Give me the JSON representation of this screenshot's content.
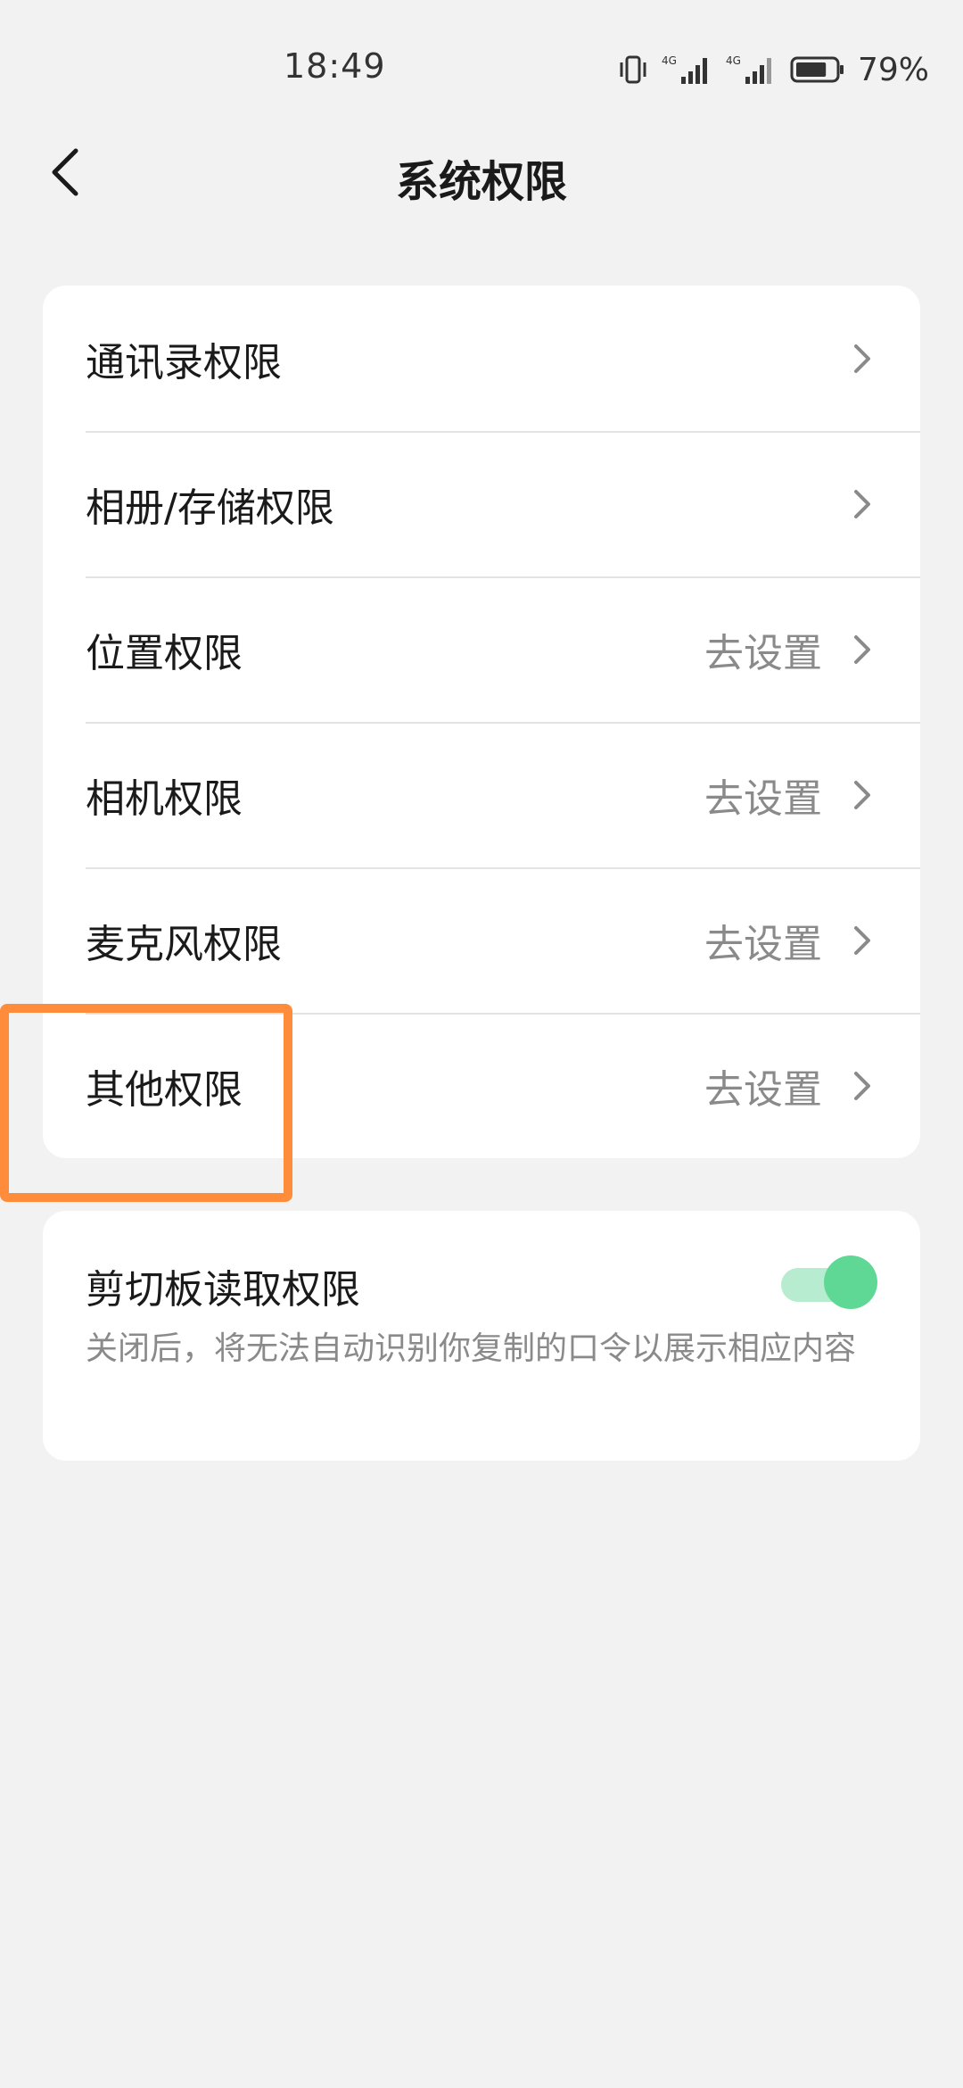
{
  "status_bar": {
    "time": "18:49",
    "network_label": "4G",
    "battery_percent": "79%",
    "battery_level": 0.79,
    "icons": [
      "vibrate-icon",
      "signal-4g-icon",
      "signal-4g-icon",
      "battery-icon"
    ]
  },
  "header": {
    "title": "系统权限",
    "back_icon": "chevron-left-icon"
  },
  "permissions": {
    "items": [
      {
        "label": "通讯录权限",
        "action": ""
      },
      {
        "label": "相册/存储权限",
        "action": ""
      },
      {
        "label": "位置权限",
        "action": "去设置"
      },
      {
        "label": "相机权限",
        "action": "去设置"
      },
      {
        "label": "麦克风权限",
        "action": "去设置"
      },
      {
        "label": "其他权限",
        "action": "去设置"
      }
    ]
  },
  "clipboard": {
    "title": "剪切板读取权限",
    "description": "关闭后，将无法自动识别你复制的口令以展示相应内容",
    "enabled": true
  },
  "colors": {
    "background": "#f2f2f2",
    "card": "#ffffff",
    "toggle_on": "#5fd895",
    "toggle_track_on": "#b7ecd0",
    "highlight": "#ff8c3a",
    "secondary_text": "#8a8a8a"
  }
}
